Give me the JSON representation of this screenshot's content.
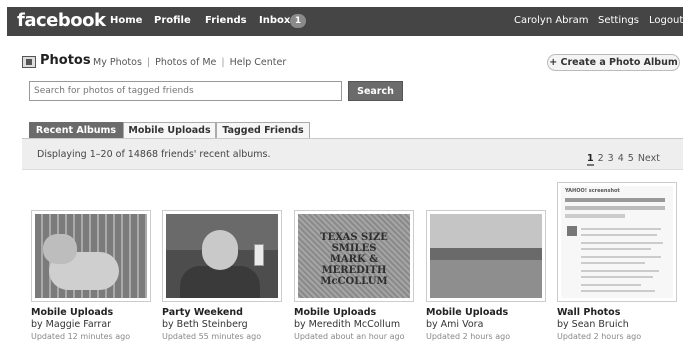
{
  "topbar": {
    "logo": "facebook",
    "nav": [
      "Home",
      "Profile",
      "Friends",
      "Inbox"
    ],
    "inbox_count": "1",
    "user_name": "Carolyn Abram",
    "settings": "Settings",
    "logout": "Logout"
  },
  "header": {
    "title": "Photos",
    "links": [
      "My Photos",
      "Photos of Me",
      "Help Center"
    ],
    "create_button": "+ Create a Photo Album"
  },
  "search": {
    "placeholder": "Search for photos of tagged friends",
    "button": "Search"
  },
  "tabs": [
    "Recent Albums",
    "Mobile Uploads",
    "Tagged Friends"
  ],
  "display_text": "Displaying 1–20 of 14868 friends' recent albums.",
  "pager": {
    "pages": [
      "1",
      "2",
      "3",
      "4",
      "5"
    ],
    "current": "1",
    "next": "Next"
  },
  "albums": [
    {
      "title": "Mobile Uploads",
      "by": "by Maggie Farrar",
      "updated": "Updated 12 minutes ago"
    },
    {
      "title": "Party Weekend",
      "by": "by Beth Steinberg",
      "updated": "Updated 55 minutes ago"
    },
    {
      "title": "Mobile Uploads",
      "by": "by Meredith McCollum",
      "updated": "Updated about an hour ago"
    },
    {
      "title": "Mobile Uploads",
      "by": "by Ami Vora",
      "updated": "Updated 2 hours ago"
    },
    {
      "title": "Wall Photos",
      "by": "by Sean Bruich",
      "updated": "Updated 2 hours ago"
    }
  ],
  "photo_text": {
    "stone_lines": [
      "TEXAS SIZE SMILES",
      "MARK & MEREDITH",
      "McCOLLUM"
    ],
    "wall_header": "YAHOO! screenshot"
  },
  "colors": {
    "topbar": "#454545",
    "active_tab": "#6b6b6b",
    "display_bar": "#eeeeee"
  }
}
